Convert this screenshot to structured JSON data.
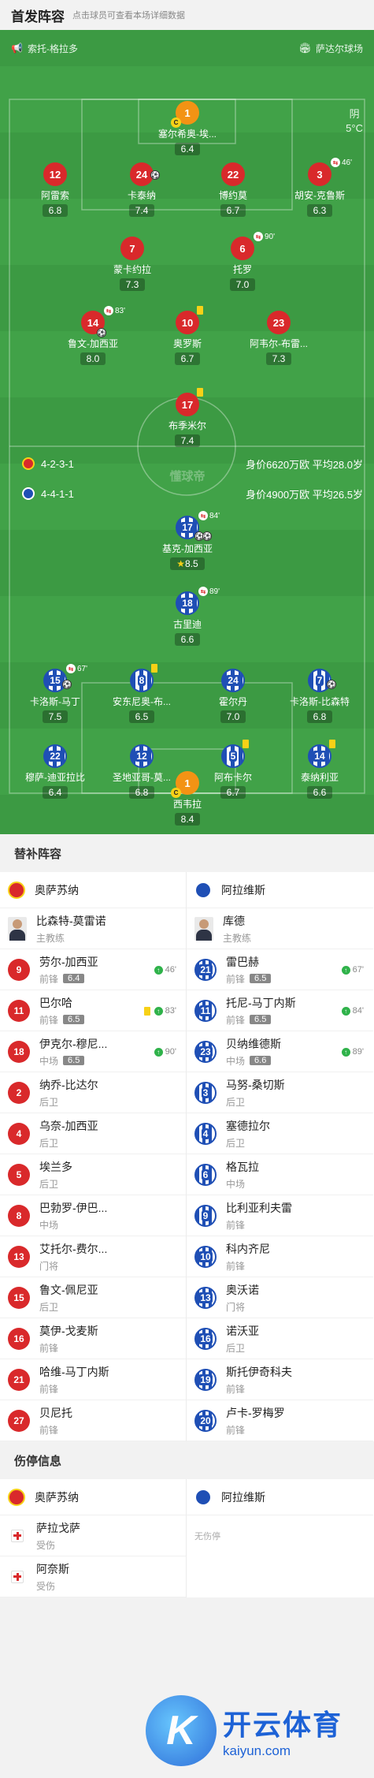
{
  "header": {
    "title": "首发阵容",
    "subtitle": "点击球员可查看本场详细数据"
  },
  "venue": {
    "referee": "索托-格拉多",
    "stadium": "萨达尔球场"
  },
  "weather": {
    "condition": "阴",
    "temp": "5°C"
  },
  "home": {
    "formation": "4-2-3-1",
    "stats": "身价6620万欧 平均28.0岁",
    "players": [
      {
        "num": "1",
        "name": "塞尔希奥-埃...",
        "rating": "6.4",
        "color": "orange",
        "captain": "C"
      },
      {
        "num": "12",
        "name": "阿雷索",
        "rating": "6.8",
        "color": "red"
      },
      {
        "num": "24",
        "name": "卡泰纳",
        "rating": "7.4",
        "color": "red"
      },
      {
        "num": "22",
        "name": "博约莫",
        "rating": "6.7",
        "color": "red"
      },
      {
        "num": "3",
        "name": "胡安-克鲁斯",
        "rating": "6.3",
        "color": "red",
        "event": "46'"
      },
      {
        "num": "7",
        "name": "蒙卡约拉",
        "rating": "7.3",
        "color": "red"
      },
      {
        "num": "6",
        "name": "托罗",
        "rating": "7.0",
        "color": "red",
        "event": "90'"
      },
      {
        "num": "14",
        "name": "鲁文-加西亚",
        "rating": "8.0",
        "color": "red",
        "event": "83'"
      },
      {
        "num": "10",
        "name": "奥罗斯",
        "rating": "6.7",
        "color": "red"
      },
      {
        "num": "23",
        "name": "阿韦尔-布雷...",
        "rating": "7.3",
        "color": "red"
      },
      {
        "num": "17",
        "name": "布季米尔",
        "rating": "7.4",
        "color": "red"
      }
    ]
  },
  "away": {
    "formation": "4-4-1-1",
    "stats": "身价4900万欧 平均26.5岁",
    "players": [
      {
        "num": "17",
        "name": "基克-加西亚",
        "rating": "8.5",
        "event": "84'",
        "star": "★"
      },
      {
        "num": "18",
        "name": "古里迪",
        "rating": "6.6",
        "event": "89'"
      },
      {
        "num": "15",
        "name": "卡洛斯-马丁",
        "rating": "7.5",
        "event": "67'"
      },
      {
        "num": "8",
        "name": "安东尼奥-布...",
        "rating": "6.5"
      },
      {
        "num": "24",
        "name": "霍尔丹",
        "rating": "7.0"
      },
      {
        "num": "7",
        "name": "卡洛斯-比森特",
        "rating": "6.8"
      },
      {
        "num": "22",
        "name": "穆萨-迪亚拉比",
        "rating": "6.4"
      },
      {
        "num": "12",
        "name": "圣地亚哥-莫...",
        "rating": "6.8"
      },
      {
        "num": "5",
        "name": "阿布卡尔",
        "rating": "6.7"
      },
      {
        "num": "14",
        "name": "泰纳利亚",
        "rating": "6.6"
      },
      {
        "num": "1",
        "name": "西韦拉",
        "rating": "8.4",
        "color": "orange",
        "captain": "C"
      }
    ]
  },
  "midlogo": "懂球帝",
  "subs": {
    "title": "替补阵容",
    "home_team": "奥萨苏纳",
    "away_team": "阿拉维斯",
    "home": [
      {
        "type": "coach",
        "name": "比森特-莫雷诺",
        "pos": "主教练"
      },
      {
        "num": "9",
        "name": "劳尔-加西亚",
        "pos": "前锋",
        "rating": "6.4",
        "in": "46'"
      },
      {
        "num": "11",
        "name": "巴尔哈",
        "pos": "前锋",
        "rating": "6.5",
        "in": "83'",
        "card": true
      },
      {
        "num": "18",
        "name": "伊克尔-穆尼...",
        "pos": "中场",
        "rating": "6.5",
        "in": "90'"
      },
      {
        "num": "2",
        "name": "纳乔-比达尔",
        "pos": "后卫"
      },
      {
        "num": "4",
        "name": "乌奈-加西亚",
        "pos": "后卫"
      },
      {
        "num": "5",
        "name": "埃兰多",
        "pos": "后卫"
      },
      {
        "num": "8",
        "name": "巴勃罗-伊巴...",
        "pos": "中场"
      },
      {
        "num": "13",
        "name": "艾托尔-费尔...",
        "pos": "门将"
      },
      {
        "num": "15",
        "name": "鲁文-佩尼亚",
        "pos": "后卫"
      },
      {
        "num": "16",
        "name": "莫伊-戈麦斯",
        "pos": "前锋"
      },
      {
        "num": "21",
        "name": "哈维-马丁内斯",
        "pos": "前锋"
      },
      {
        "num": "27",
        "name": "贝尼托",
        "pos": "前锋"
      }
    ],
    "away": [
      {
        "type": "coach",
        "name": "库德",
        "pos": "主教练"
      },
      {
        "num": "21",
        "name": "雷巴赫",
        "pos": "前锋",
        "rating": "6.5",
        "in": "67'"
      },
      {
        "num": "11",
        "name": "托尼-马丁内斯",
        "pos": "前锋",
        "rating": "6.5",
        "in": "84'"
      },
      {
        "num": "23",
        "name": "贝纳维德斯",
        "pos": "中场",
        "rating": "6.6",
        "in": "89'"
      },
      {
        "num": "3",
        "name": "马努-桑切斯",
        "pos": "后卫"
      },
      {
        "num": "4",
        "name": "塞德拉尔",
        "pos": "后卫"
      },
      {
        "num": "6",
        "name": "格瓦拉",
        "pos": "中场"
      },
      {
        "num": "9",
        "name": "比利亚利夫雷",
        "pos": "前锋"
      },
      {
        "num": "10",
        "name": "科内齐尼",
        "pos": "前锋"
      },
      {
        "num": "13",
        "name": "奥沃诺",
        "pos": "门将"
      },
      {
        "num": "16",
        "name": "诺沃亚",
        "pos": "后卫"
      },
      {
        "num": "19",
        "name": "斯托伊奇科夫",
        "pos": "前锋"
      },
      {
        "num": "20",
        "name": "卢卡-罗梅罗",
        "pos": "前锋"
      }
    ]
  },
  "injuries": {
    "title": "伤停信息",
    "home_team": "奥萨苏纳",
    "away_team": "阿拉维斯",
    "none_text": "无伤停",
    "home": [
      {
        "name": "萨拉戈萨",
        "status": "受伤"
      },
      {
        "name": "阿奈斯",
        "status": "受伤"
      }
    ]
  },
  "watermark": {
    "cn": "开云体育",
    "en": "kaiyun.com",
    "letter": "K"
  }
}
